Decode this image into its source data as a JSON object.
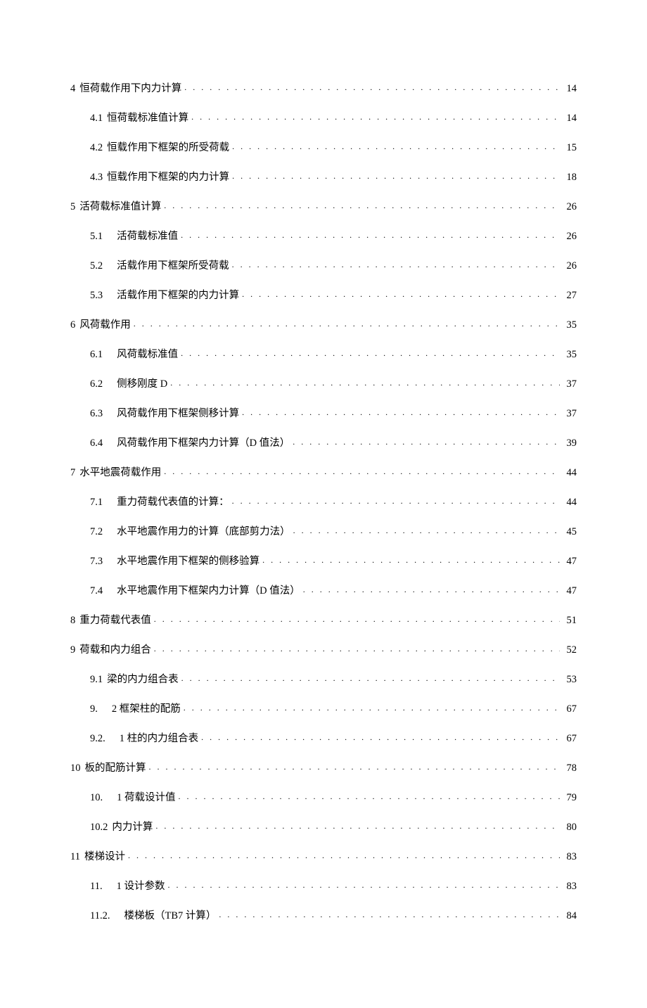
{
  "toc": [
    {
      "indent": 0,
      "num": "4",
      "numSpaced": false,
      "title": "恒荷载作用下内力计算",
      "page": "14"
    },
    {
      "indent": 1,
      "num": "4.1",
      "numSpaced": false,
      "title": "恒荷载标准值计算",
      "page": "14"
    },
    {
      "indent": 1,
      "num": "4.2",
      "numSpaced": false,
      "title": "恒载作用下框架的所受荷载",
      "page": "15"
    },
    {
      "indent": 1,
      "num": "4.3",
      "numSpaced": false,
      "title": "恒载作用下框架的内力计算",
      "page": "18"
    },
    {
      "indent": 0,
      "num": "5",
      "numSpaced": false,
      "title": "活荷载标准值计算",
      "page": "26"
    },
    {
      "indent": 1,
      "num": "5.1",
      "numSpaced": true,
      "title": "活荷载标准值",
      "page": "26"
    },
    {
      "indent": 1,
      "num": "5.2",
      "numSpaced": true,
      "title": "活载作用下框架所受荷载",
      "page": "26"
    },
    {
      "indent": 1,
      "num": "5.3",
      "numSpaced": true,
      "title": "活载作用下框架的内力计算",
      "page": "27"
    },
    {
      "indent": 0,
      "num": "6",
      "numSpaced": false,
      "title": "风荷载作用",
      "page": "35"
    },
    {
      "indent": 1,
      "num": "6.1",
      "numSpaced": true,
      "title": "风荷载标准值",
      "page": "35"
    },
    {
      "indent": 1,
      "num": "6.2",
      "numSpaced": true,
      "title": "侧移刚度 D",
      "page": "37"
    },
    {
      "indent": 1,
      "num": "6.3",
      "numSpaced": true,
      "title": "风荷载作用下框架侧移计算",
      "page": "37"
    },
    {
      "indent": 1,
      "num": "6.4",
      "numSpaced": true,
      "title": "风荷载作用下框架内力计算（D 值法）",
      "page": "39"
    },
    {
      "indent": 0,
      "num": "7",
      "numSpaced": false,
      "title": "水平地震荷载作用",
      "page": "44"
    },
    {
      "indent": 1,
      "num": "7.1",
      "numSpaced": true,
      "title": "重力荷载代表值的计算：",
      "page": "44"
    },
    {
      "indent": 1,
      "num": "7.2",
      "numSpaced": true,
      "title": "水平地震作用力的计算（底部剪力法）",
      "page": "45"
    },
    {
      "indent": 1,
      "num": "7.3",
      "numSpaced": true,
      "title": "水平地震作用下框架的侧移验算",
      "page": "47"
    },
    {
      "indent": 1,
      "num": "7.4",
      "numSpaced": true,
      "title": "水平地震作用下框架内力计算（D 值法）",
      "page": "47"
    },
    {
      "indent": 0,
      "num": "8",
      "numSpaced": false,
      "title": "重力荷载代表值",
      "page": "51"
    },
    {
      "indent": 0,
      "num": "9",
      "numSpaced": false,
      "title": "荷载和内力组合",
      "page": "52"
    },
    {
      "indent": 1,
      "num": "9.1",
      "numSpaced": false,
      "title": "梁的内力组合表",
      "page": "53"
    },
    {
      "indent": 1,
      "num": "9.",
      "numSpaced": true,
      "title": "2 框架柱的配筋",
      "page": "67"
    },
    {
      "indent": 1,
      "num": "9.2.",
      "numSpaced": true,
      "title": "1 柱的内力组合表",
      "page": "67"
    },
    {
      "indent": 0,
      "num": "10",
      "numSpaced": false,
      "title": "板的配筋计算",
      "page": "78"
    },
    {
      "indent": 1,
      "num": "10.",
      "numSpaced": true,
      "title": "1 荷载设计值",
      "page": "79"
    },
    {
      "indent": 1,
      "num": "10.2",
      "numSpaced": false,
      "title": "内力计算",
      "page": "80"
    },
    {
      "indent": 0,
      "num": "11",
      "numSpaced": false,
      "title": "楼梯设计",
      "page": "83"
    },
    {
      "indent": 1,
      "num": "11.",
      "numSpaced": true,
      "title": "1 设计参数",
      "page": "83"
    },
    {
      "indent": 1,
      "num": "11.2.",
      "numSpaced": true,
      "title": "楼梯板（TB7 计算）",
      "page": "84"
    }
  ]
}
